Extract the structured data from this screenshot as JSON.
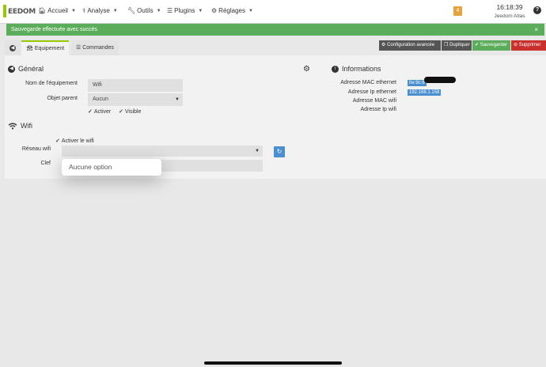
{
  "nav": {
    "logo_text": "EEDOM",
    "items": [
      {
        "label": "Accueil"
      },
      {
        "label": "Analyse"
      },
      {
        "label": "Outils"
      },
      {
        "label": "Plugins"
      },
      {
        "label": "Réglages"
      }
    ],
    "badge_count": "4",
    "time": "16:18:39",
    "system_name": "Jeedom Atlas",
    "help": "?"
  },
  "alert": {
    "message": "Sauvegarde effectuée avec succès",
    "close": "×"
  },
  "tabs": [
    {
      "label": "Equipement"
    },
    {
      "label": "Commandes"
    }
  ],
  "actions": {
    "config": "Configuration avancée",
    "duplicate": "Dupliquer",
    "save": "Sauvegarder",
    "delete": "Supprimer"
  },
  "general": {
    "title": "Général",
    "name_label": "Nom de l'équipement",
    "name_value": "Wifi",
    "parent_label": "Objet parent",
    "parent_value": "Aucun",
    "activate": "Activer",
    "visible": "Visible"
  },
  "wifi": {
    "title": "Wifi",
    "activate_wifi": "Activer le wifi",
    "network_label": "Réseau wifi",
    "key_label": "Clef",
    "dropdown_option": "Aucune option"
  },
  "info": {
    "title": "Informations",
    "rows": [
      {
        "label": "Adresse MAC ethernet",
        "value": "0e:9c:6"
      },
      {
        "label": "Adresse Ip ethernet",
        "value": "192.168.1.158"
      },
      {
        "label": "Adresse MAC wifi",
        "value": ""
      },
      {
        "label": "Adresse Ip wifi",
        "value": ""
      }
    ]
  },
  "colors": {
    "brand": "#93ca02",
    "success": "#5bad5b",
    "primary": "#4a8fd0",
    "danger": "#c9302c",
    "neutral_btn": "#555555",
    "badge": "#e8a23b"
  }
}
